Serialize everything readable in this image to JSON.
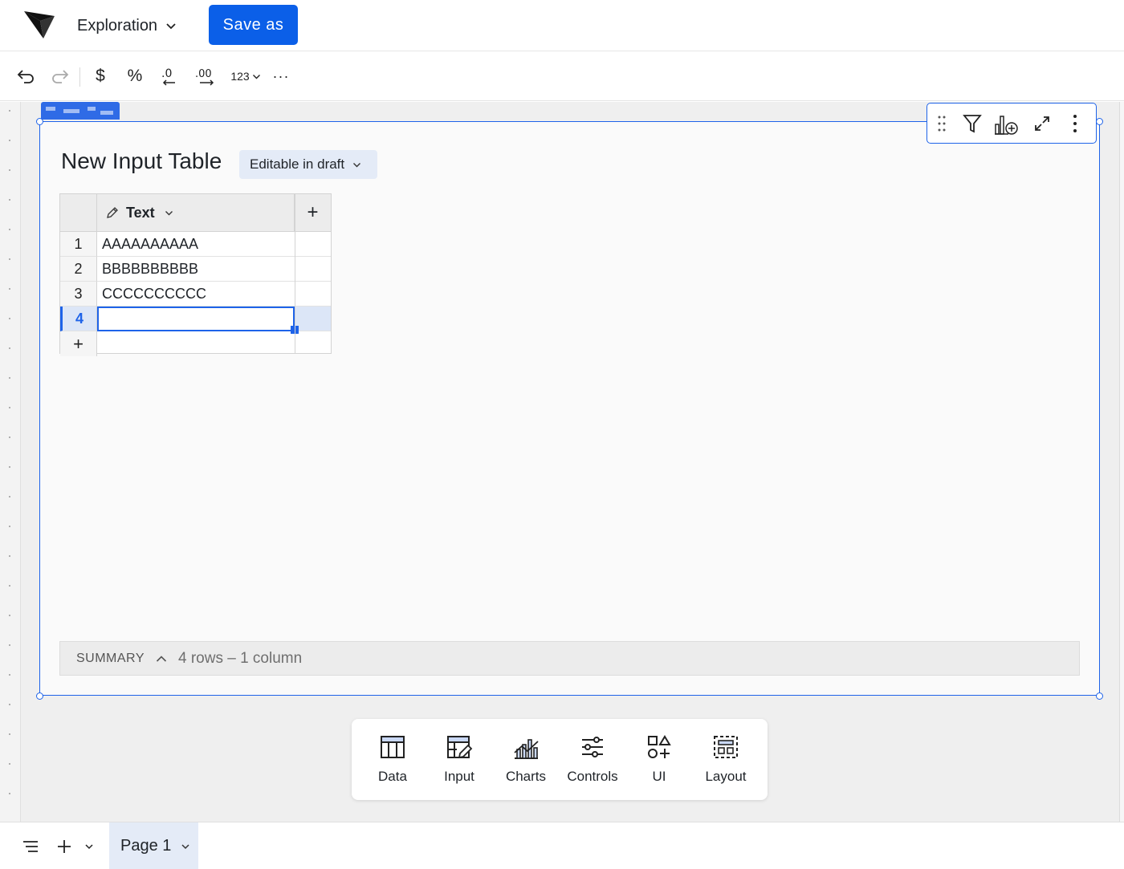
{
  "app": {
    "title": "Exploration",
    "save_label": "Save as"
  },
  "format_toolbar": {
    "items": [
      {
        "icon": "undo-icon"
      },
      {
        "icon": "redo-icon"
      },
      {
        "icon": "currency-icon",
        "label": "$"
      },
      {
        "icon": "percent-icon",
        "label": "%"
      },
      {
        "icon": "decrease-decimals-icon",
        "label": ".0"
      },
      {
        "icon": "increase-decimals-icon",
        "label": ".00"
      },
      {
        "icon": "number-format-icon",
        "label": "123"
      },
      {
        "icon": "more-icon",
        "label": "···"
      }
    ]
  },
  "element": {
    "title": "New Input Table",
    "edit_mode": "Editable in draft",
    "toolbar_icons": [
      "drag-handle-icon",
      "filter-icon",
      "add-chart-icon",
      "expand-icon",
      "more-vertical-icon"
    ],
    "column": {
      "name": "Text",
      "icon": "pencil-icon"
    },
    "add_column": "+",
    "rows": [
      {
        "num": "1",
        "value": "AAAAAAAAAA"
      },
      {
        "num": "2",
        "value": "BBBBBBBBBB"
      },
      {
        "num": "3",
        "value": "CCCCCCCCCC"
      },
      {
        "num": "4",
        "value": ""
      }
    ],
    "add_row": "+",
    "summary": {
      "label": "SUMMARY",
      "counts": "4 rows – 1 column"
    }
  },
  "dock": {
    "items": [
      {
        "label": "Data",
        "icon": "table-icon"
      },
      {
        "label": "Input",
        "icon": "input-table-icon"
      },
      {
        "label": "Charts",
        "icon": "charts-icon"
      },
      {
        "label": "Controls",
        "icon": "sliders-icon"
      },
      {
        "label": "UI",
        "icon": "shapes-icon"
      },
      {
        "label": "Layout",
        "icon": "layout-icon"
      }
    ]
  },
  "bottom": {
    "page_tab": "Page 1"
  },
  "colors": {
    "accent": "#0b5fe8",
    "selection": "#1e63e9",
    "badge_bg": "#e4ebf7",
    "canvas_bg": "#efefef"
  }
}
